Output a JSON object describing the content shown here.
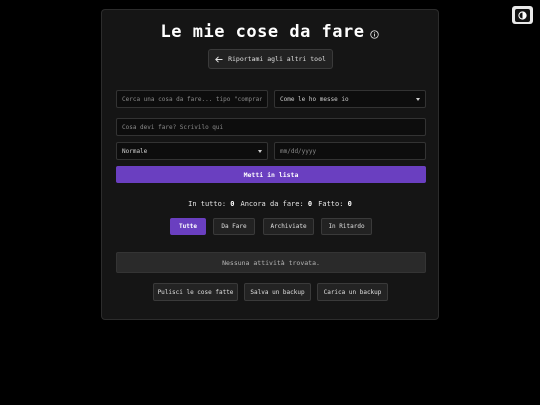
{
  "header": {
    "title": "Le mie cose da fare",
    "back_label": "Riportami agli altri tool"
  },
  "search": {
    "placeholder": "Cerca una cosa da fare... tipo \"comprare il l"
  },
  "sort": {
    "selected": "Come le ho messe io"
  },
  "task_input": {
    "placeholder": "Cosa devi fare? Scrivilo qui"
  },
  "priority": {
    "selected": "Normale"
  },
  "date": {
    "placeholder": "mm/dd/yyyy"
  },
  "add_button": "Metti in lista",
  "stats": {
    "total_label": "In tutto:",
    "total": "0",
    "todo_label": "Ancora da fare:",
    "todo": "0",
    "done_label": "Fatto:",
    "done": "0"
  },
  "filters": [
    {
      "label": "Tutte",
      "active": true
    },
    {
      "label": "Da Fare",
      "active": false
    },
    {
      "label": "Archiviate",
      "active": false
    },
    {
      "label": "In Ritardo",
      "active": false
    }
  ],
  "empty_message": "Nessuna attività trovata.",
  "actions": {
    "clear": "Pulisci le cose fatte",
    "save": "Salva un backup",
    "load": "Carica un backup"
  },
  "colors": {
    "accent": "#6a3fc0",
    "background": "#000000",
    "card": "#151515"
  }
}
